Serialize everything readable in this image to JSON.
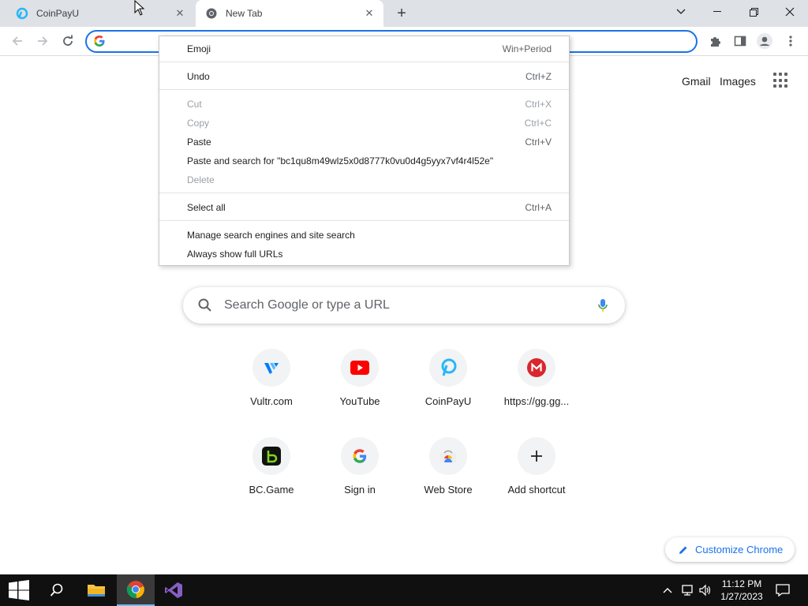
{
  "tabs": [
    {
      "title": "CoinPayU",
      "active": false
    },
    {
      "title": "New Tab",
      "active": true
    }
  ],
  "omnibox": {
    "value": ""
  },
  "ntp": {
    "gmail": "Gmail",
    "images": "Images",
    "search_placeholder": "Search Google or type a URL",
    "shortcuts": [
      {
        "label": "Vultr.com",
        "icon": "vultr-icon"
      },
      {
        "label": "YouTube",
        "icon": "youtube-icon"
      },
      {
        "label": "CoinPayU",
        "icon": "coinpayu-icon"
      },
      {
        "label": "https://gg.gg...",
        "icon": "mega-icon"
      },
      {
        "label": "BC.Game",
        "icon": "bcgame-icon"
      },
      {
        "label": "Sign in",
        "icon": "google-icon"
      },
      {
        "label": "Web Store",
        "icon": "webstore-icon"
      },
      {
        "label": "Add shortcut",
        "icon": "plus-icon"
      }
    ],
    "customize": "Customize Chrome"
  },
  "context_menu": {
    "emoji": {
      "label": "Emoji",
      "shortcut": "Win+Period"
    },
    "undo": {
      "label": "Undo",
      "shortcut": "Ctrl+Z"
    },
    "cut": {
      "label": "Cut",
      "shortcut": "Ctrl+X"
    },
    "copy": {
      "label": "Copy",
      "shortcut": "Ctrl+C"
    },
    "paste": {
      "label": "Paste",
      "shortcut": "Ctrl+V"
    },
    "paste_search": {
      "label": "Paste and search for \"bc1qu8m49wlz5x0d8777k0vu0d4g5yyx7vf4r4l52e\""
    },
    "delete": {
      "label": "Delete"
    },
    "select_all": {
      "label": "Select all",
      "shortcut": "Ctrl+A"
    },
    "manage_search": {
      "label": "Manage search engines and site search"
    },
    "full_urls": {
      "label": "Always show full URLs"
    }
  },
  "taskbar": {
    "time": "11:12 PM",
    "date": "1/27/2023"
  },
  "colors": {
    "accent": "#1a73e8",
    "tabstrip": "#dee1e6",
    "taskbar": "#101010"
  }
}
